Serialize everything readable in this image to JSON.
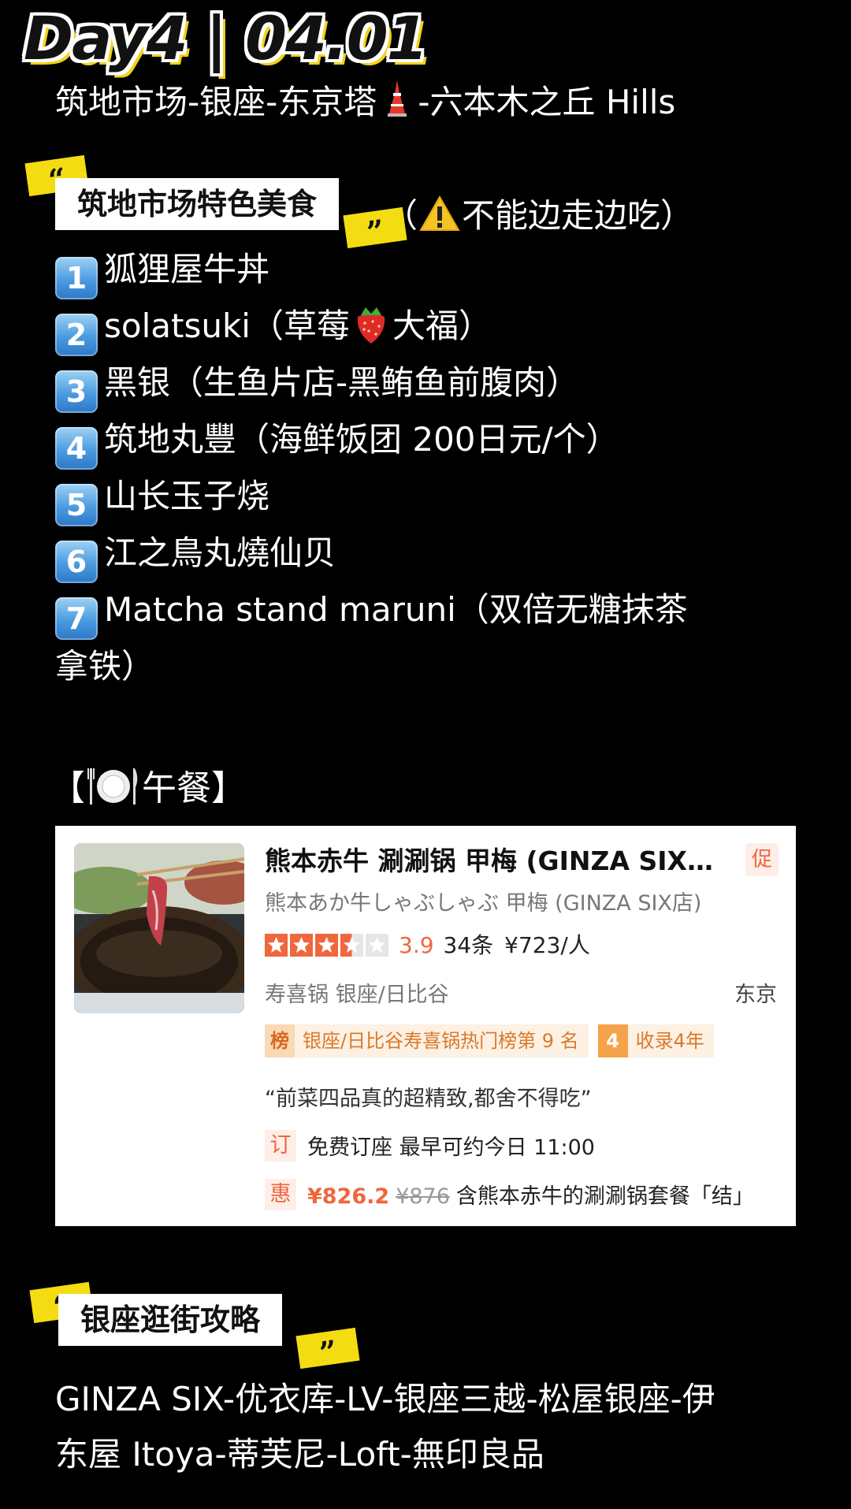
{
  "header": {
    "day_title": "Day4 | 04.01",
    "route_part1": "筑地市场-银座-东京塔",
    "route_part2": "-六本木之丘 Hills"
  },
  "section_food": {
    "banner": "筑地市场特色美食",
    "paren_open": "（",
    "note": "不能边走边吃）",
    "items": [
      {
        "num": "1",
        "text": "狐狸屋牛丼"
      },
      {
        "num": "2",
        "text_a": "solatsuki（草莓",
        "text_b": "大福）"
      },
      {
        "num": "3",
        "text": "黑银（生鱼片店-黑鲔鱼前腹肉）"
      },
      {
        "num": "4",
        "text": "筑地丸豐（海鲜饭团 200日元/个）"
      },
      {
        "num": "5",
        "text": "山长玉子烧"
      },
      {
        "num": "6",
        "text": "江之鳥丸燒仙贝"
      },
      {
        "num": "7",
        "text": "Matcha stand maruni（双倍无糖抹茶"
      }
    ],
    "item7_cont": "拿铁）"
  },
  "lunch": {
    "open": "【",
    "close": "午餐】"
  },
  "card": {
    "title": "熊本赤牛 涮涮锅 甲梅 (GINZA SIX…",
    "promo": "促",
    "subtitle": "熊本あか牛しゃぶしゃぶ 甲梅 (GINZA SIX店)",
    "rating": 3.5,
    "score": "3.9",
    "reviews": "34条",
    "price": "¥723/人",
    "category": "寿喜锅  银座/日比谷",
    "city": "东京",
    "rank_icon": "榜",
    "rank_text": "银座/日比谷寿喜锅热门榜第 9 名",
    "years_icon": "4",
    "years_text": "收录4年",
    "quote": "“前菜四品真的超精致,都舍不得吃”",
    "booking_icon": "订",
    "booking_text": "免费订座 最早可约今日 11:00",
    "deal_icon": "惠",
    "deal_price": "¥826.2",
    "old_price": "¥876",
    "deal_text": "含熊本赤牛的涮涮锅套餐「结」"
  },
  "section_ginza": {
    "banner": "银座逛街攻略",
    "line1": "GINZA SIX-优衣库-LV-银座三越-松屋银座-伊",
    "line2": "东屋 Itoya-蒂芙尼-Loft-無印良品"
  },
  "quote_marks": {
    "open": "“",
    "close": "”"
  },
  "colors": {
    "accent_yellow": "#f4dc12",
    "card_orange": "#f0663d",
    "badge_blue": "#3c8ad6"
  }
}
